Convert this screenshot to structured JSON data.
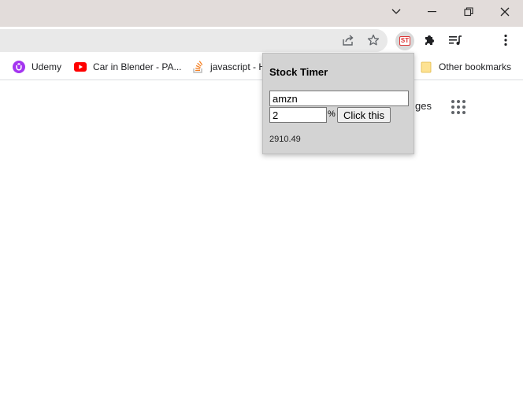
{
  "window": {
    "controls": {
      "tab_search": "chevron-down-icon",
      "minimize": "minimize-icon",
      "restore": "restore-icon",
      "close": "close-icon"
    }
  },
  "toolbar": {
    "extension_badge": "ST",
    "icons": [
      "share-icon",
      "star-icon",
      "puzzle-icon",
      "reading-list-icon",
      "kebab-menu-icon"
    ]
  },
  "bookmarks": {
    "items": [
      {
        "label": "Udemy",
        "icon": "udemy-icon",
        "color": "#a435f0"
      },
      {
        "label": "Car in Blender - PA...",
        "icon": "youtube-icon",
        "color": "#ff0000"
      },
      {
        "label": "javascript - H",
        "icon": "stackoverflow-icon",
        "color": "#f48024"
      },
      {
        "label": "Other bookmarks",
        "icon": "folder-icon",
        "color": "#fdd663"
      }
    ]
  },
  "page": {
    "images_link": "ges"
  },
  "popup": {
    "title": "Stock Timer",
    "ticker_value": "amzn",
    "percent_value": "2",
    "percent_label": "%",
    "button_label": "Click this",
    "price": "2910.49"
  }
}
